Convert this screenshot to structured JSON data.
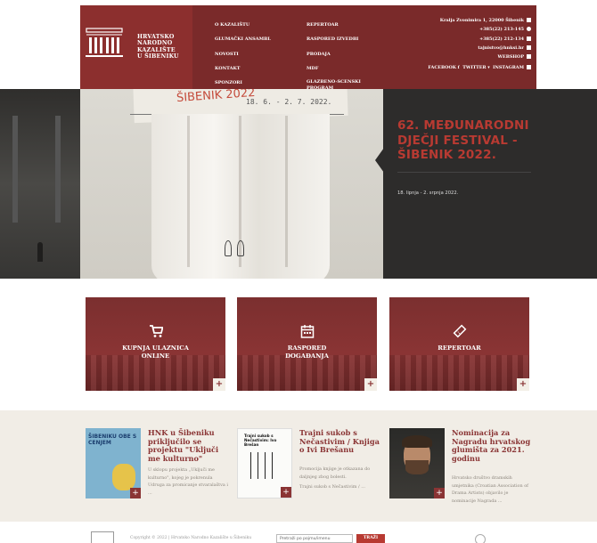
{
  "header": {
    "logo_lines": [
      "HRVATSKO",
      "NARODNO",
      "KAZALIŠTE",
      "U ŠIBENIKU"
    ],
    "nav_col1": [
      "O KAZALIŠTU",
      "GLUMAČKI ANSAMBL",
      "NOVOSTI",
      "KONTAKT",
      "SPONZORI"
    ],
    "nav_col2": [
      "REPERTOAR",
      "RASPORED IZVEDBI",
      "PRODAJA",
      "MDF"
    ],
    "nav_col2_last": [
      "GLAZBENO-SCENSKI",
      "PROGRAM"
    ],
    "contact": {
      "address": "Kralja Zvonimira 1, 22000 Šibenik",
      "phone1": "+385(22) 213-145",
      "phone2": "+385(22) 212-134",
      "email": "tajnistvo@hnksi.hr",
      "webshop": "WEBSHOP",
      "social": [
        "FACEBOOK",
        "TWITTER",
        "INSTAGRAM"
      ]
    }
  },
  "hero": {
    "scrawl_red": "ŠIBENIK 2022",
    "scrawl_date": "18. 6. - 2. 7. 2022.",
    "title": "62. MEĐUNARODNI DJEČJI FESTIVAL - ŠIBENIK 2022.",
    "date": "18. lipnja - 2. srpnja 2022."
  },
  "tiles": [
    {
      "line1": "KUPNJA ULAZNICA",
      "line2": "ONLINE",
      "icon": "cart-icon"
    },
    {
      "line1": "RASPORED",
      "line2": "DOGAĐANJA",
      "icon": "calendar-icon"
    },
    {
      "line1": "REPERTOAR",
      "line2": "",
      "icon": "ticket-icon"
    }
  ],
  "news": [
    {
      "title": "HNK u Šibeniku priključilo se projektu \"Uključi me kulturno\"",
      "body": "U sklopu projekta „Uključi me kulturno\", kojeg je pokrenula Udruga za promicanje stvaralaštva i ...",
      "img_text": "ŠIBENIKU OBE S CENJEM"
    },
    {
      "title": "Trajni sukob s Nečastivim / Knjiga o Ivi Brešanu",
      "body1": "Promocija knjige je otkazana do daljnjeg zbog bolesti.",
      "body2": "Trajni sukob s Nečastivim / ...",
      "img_text": "Trajni sukob s Nečastivim: Ivo Brešan"
    },
    {
      "title": "Nominacija za Nagradu hrvatskog glumišta za 2021. godinu",
      "body": "Hrvatsko društvo dramskih umjetnika (Croatian Association of Drama Artists) objavilo je nominacije Nagrada ..."
    }
  ],
  "footer": {
    "copyright": "Copyright © 2022 | Hrvatsko Narodno Kazalište u Šibeniku",
    "search_placeholder": "Pretraži po pojmu/imenu",
    "search_button": "TRAŽI"
  },
  "colors": {
    "brand_dark_red": "#7a2a2a",
    "brand_red": "#8a3434",
    "accent_red": "#b83a32",
    "news_bg": "#f1ede6"
  }
}
